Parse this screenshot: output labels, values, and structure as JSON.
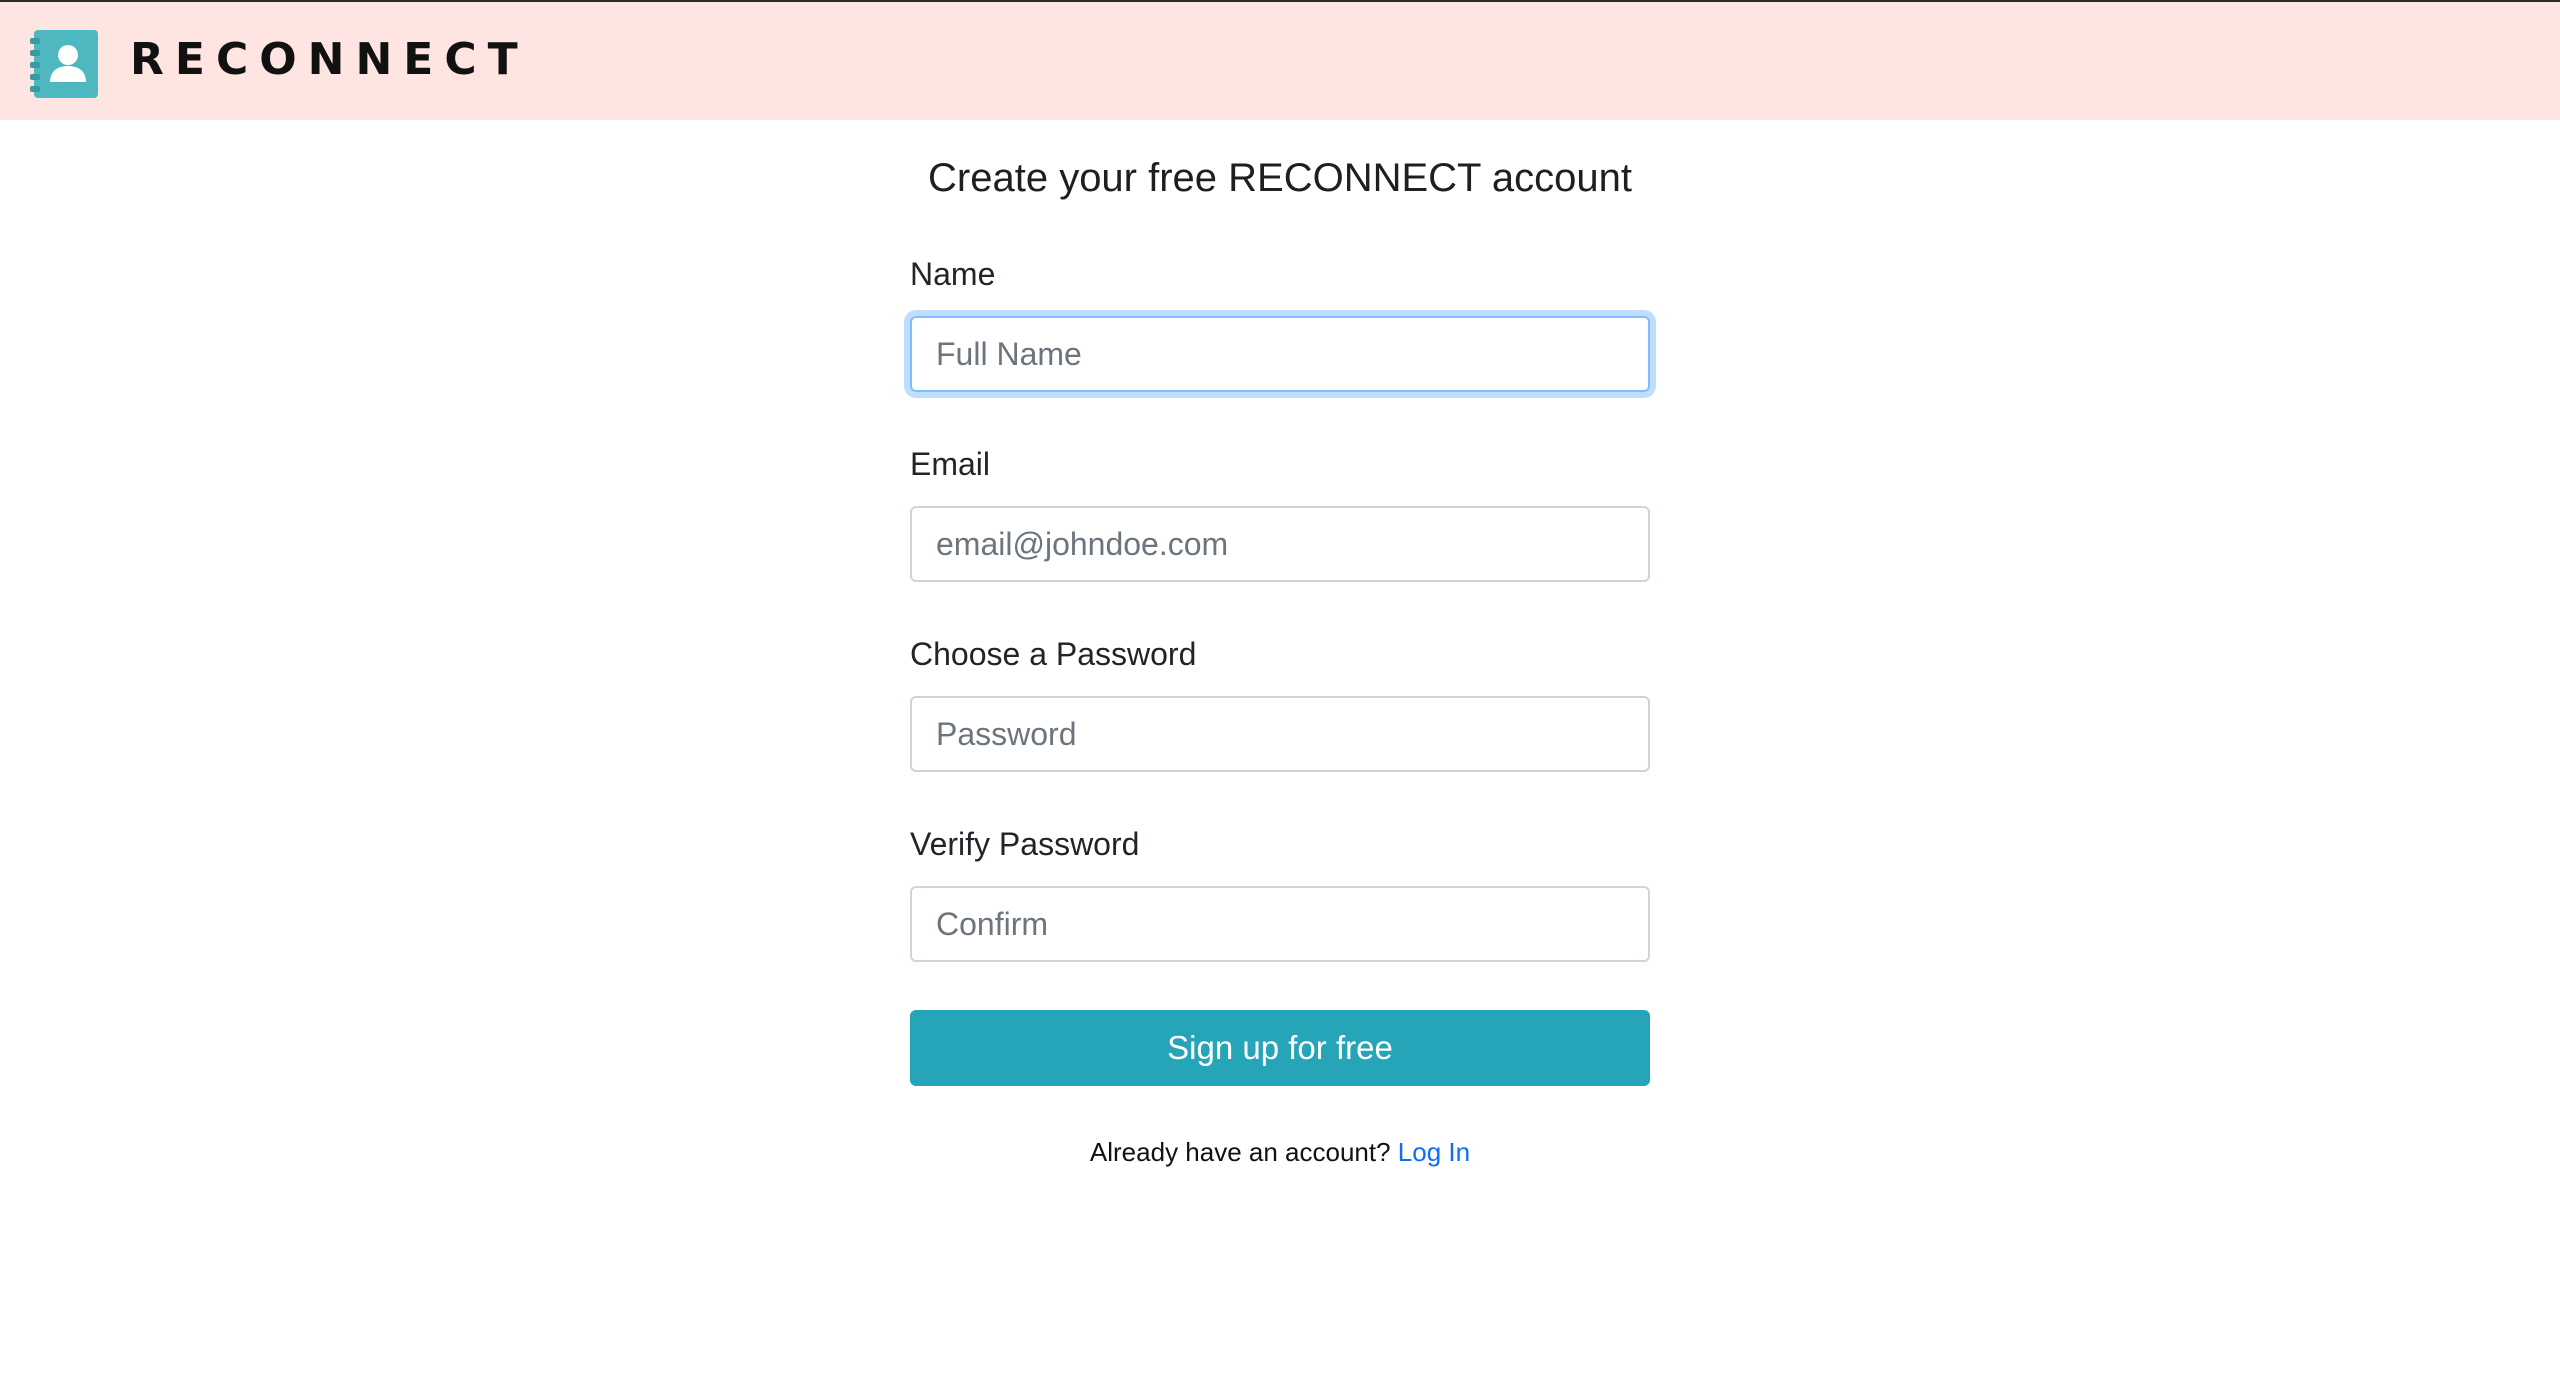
{
  "header": {
    "brand": "RECONNECT",
    "logo_icon": "contact-book-icon",
    "background_color": "#ffe5e1",
    "logo_color": "#4db8c0"
  },
  "form": {
    "title": "Create your free RECONNECT account",
    "fields": [
      {
        "label": "Name",
        "placeholder": "Full Name",
        "value": ""
      },
      {
        "label": "Email",
        "placeholder": "email@johndoe.com",
        "value": ""
      },
      {
        "label": "Choose a Password",
        "placeholder": "Password",
        "value": ""
      },
      {
        "label": "Verify Password",
        "placeholder": "Confirm",
        "value": ""
      }
    ],
    "submit_label": "Sign up for free",
    "submit_color": "#26a5b8",
    "login_prompt": "Already have an account?",
    "login_link": "Log In",
    "link_color": "#0d6efd"
  }
}
